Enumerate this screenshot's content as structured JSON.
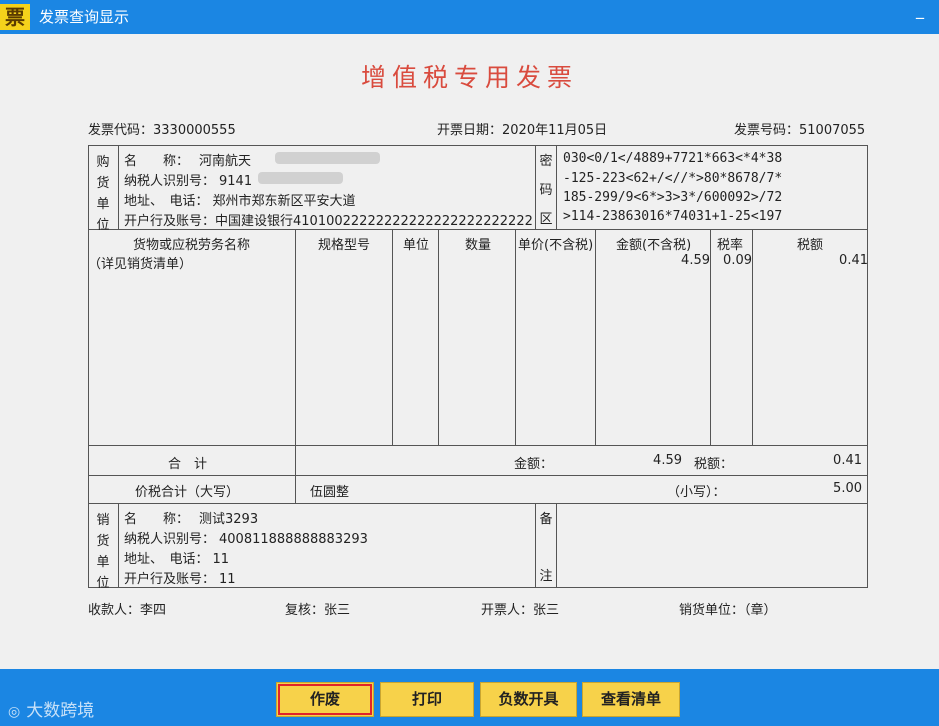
{
  "window": {
    "title": "发票查询显示",
    "app_icon_char": "票",
    "minimize": "_"
  },
  "invoice": {
    "title": "增值税专用发票",
    "code_label": "发票代码：",
    "code": "3330000555",
    "date_label": "开票日期：",
    "date": "2020年11月05日",
    "number_label": "发票号码：",
    "number": "51007055",
    "buyer": {
      "side_label": [
        "购",
        "货",
        "单",
        "位"
      ],
      "name_label": "名　　称：",
      "name": "河南航天",
      "tax_label": "纳税人识别号：",
      "tax_id": "9141",
      "addr_label": "地址、　电话：",
      "addr": "郑州市郑东新区平安大道",
      "bank_label": "开户行及账号：",
      "bank": "中国建设银行410100222222222222222222222222"
    },
    "cipher": {
      "side_label": [
        "密",
        "码",
        "区"
      ],
      "lines": [
        "030<0/1</4889+7721*663<*4*38",
        "-125-223<62+/<//*>80*8678/7*",
        "185-299/9<6*>3>3*/600092>/72",
        ">114-23863016*74031+1-25<197"
      ]
    },
    "columns": [
      "货物或应税劳务名称",
      "规格型号",
      "单位",
      "数量",
      "单价(不含税)",
      "金额(不含税)",
      "税率",
      "税额"
    ],
    "items": [
      {
        "name": "（详见销货清单）",
        "spec": "",
        "unit": "",
        "qty": "",
        "price": "",
        "amount": "4.59",
        "rate": "0.09",
        "tax": "0.41"
      }
    ],
    "total": {
      "label": "合　计",
      "amount_label": "金额：",
      "amount": "4.59",
      "tax_label": "税额：",
      "tax": "0.41"
    },
    "grand": {
      "label": "价税合计（大写）",
      "words": "伍圆整",
      "small_label": "（小写）：",
      "value": "5.00"
    },
    "seller": {
      "side_label": [
        "销",
        "货",
        "单",
        "位"
      ],
      "name_label": "名　　称：",
      "name": "测试3293",
      "tax_label": "纳税人识别号：",
      "tax_id": "400811888888883293",
      "addr_label": "地址、　电话：",
      "addr": "11",
      "bank_label": "开户行及账号：",
      "bank": "11"
    },
    "remark_label": [
      "备",
      "注"
    ],
    "footer": {
      "payee": "收款人：李四",
      "reviewer": "复核：张三",
      "issuer": "开票人：张三",
      "seller_unit": "销货单位：（章）"
    }
  },
  "buttons": {
    "void": "作废",
    "print": "打印",
    "negative": "负数开具",
    "view_list": "查看清单"
  },
  "watermark": "大数跨境"
}
